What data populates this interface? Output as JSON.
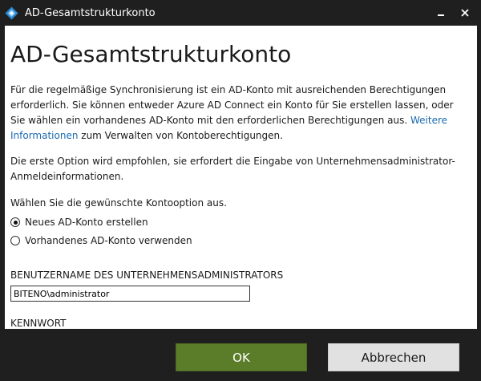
{
  "window": {
    "title": "AD-Gesamtstrukturkonto",
    "app_icon": "azure-ad-connect-diamond-icon",
    "minimize_icon": "minimize-icon",
    "close_icon": "close-icon"
  },
  "page": {
    "heading": "AD-Gesamtstrukturkonto",
    "intro_text": "Für die regelmäßige Synchronisierung ist ein AD-Konto mit ausreichenden Berechtigungen erforderlich. Sie können entweder Azure AD Connect ein Konto für Sie erstellen lassen, oder Sie wählen ein vorhandenes AD-Konto mit den erforderlichen Berechtigungen aus. ",
    "link_text": "Weitere Informationen",
    "intro_suffix": " zum Verwalten von Kontoberechtigungen.",
    "recommendation_text": "Die erste Option wird empfohlen, sie erfordert die Eingabe von Unternehmensadministrator-Anmeldeinformationen.",
    "choose_text": "Wählen Sie die gewünschte Kontooption aus."
  },
  "options": [
    {
      "label": "Neues AD-Konto erstellen",
      "selected": true
    },
    {
      "label": "Vorhandenes AD-Konto verwenden",
      "selected": false
    }
  ],
  "form": {
    "username_label": "BENUTZERNAME DES UNTERNEHMENSADMINISTRATORS",
    "username_value": "BITENO\\administrator",
    "password_label": "KENNWORT"
  },
  "buttons": {
    "ok_label": "OK",
    "cancel_label": "Abbrechen"
  },
  "colors": {
    "ok_button": "#5b7d2a",
    "link": "#1a6ab0",
    "frame": "#1f1f1f"
  }
}
